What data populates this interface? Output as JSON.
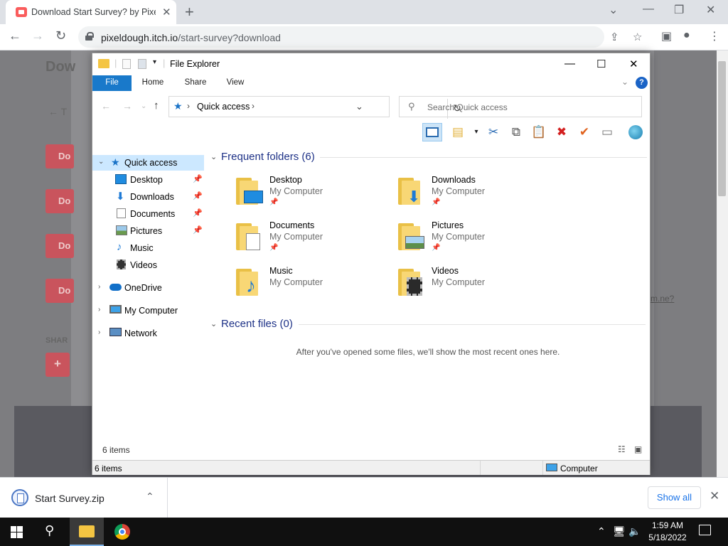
{
  "browser": {
    "tab_title": "Download Start Survey? by PixelD",
    "tab_close": "✕",
    "new_tab": "+",
    "url_host": "pixeldough.itch.io",
    "url_path": "/start-survey?download"
  },
  "page_behind": {
    "heading_fragment": "Dow",
    "back_fragment": "← T",
    "button_fragment": "Do",
    "share_fragment": "SHAR",
    "plus": "+",
    "link_fragment": "m.ne?"
  },
  "explorer": {
    "title": "File Explorer",
    "ribbon_tabs": [
      "File",
      "Home",
      "Share",
      "View"
    ],
    "help": "?",
    "address": "Quick access",
    "search_placeholder": "Search Quick access",
    "nav": [
      {
        "label": "Quick access",
        "icon": "star-icon",
        "pinned": false,
        "expandable": true
      },
      {
        "label": "Desktop",
        "icon": "desktop-icon",
        "pinned": true
      },
      {
        "label": "Downloads",
        "icon": "download-arrow-icon",
        "pinned": true
      },
      {
        "label": "Documents",
        "icon": "documents-icon",
        "pinned": true
      },
      {
        "label": "Pictures",
        "icon": "pictures-icon",
        "pinned": true
      },
      {
        "label": "Music",
        "icon": "music-icon",
        "pinned": false
      },
      {
        "label": "Videos",
        "icon": "videos-icon",
        "pinned": false
      },
      {
        "label": "OneDrive",
        "icon": "cloud-icon",
        "expandable": true
      },
      {
        "label": "My Computer",
        "icon": "computer-icon",
        "expandable": true
      },
      {
        "label": "Network",
        "icon": "network-icon",
        "expandable": true
      }
    ],
    "frequent_header": "Frequent folders (6)",
    "folders": [
      {
        "name": "Desktop",
        "location": "My Computer",
        "pinned": true,
        "overlay": "desktop"
      },
      {
        "name": "Downloads",
        "location": "My Computer",
        "pinned": true,
        "overlay": "download"
      },
      {
        "name": "Documents",
        "location": "My Computer",
        "pinned": true,
        "overlay": "document"
      },
      {
        "name": "Pictures",
        "location": "My Computer",
        "pinned": true,
        "overlay": "picture"
      },
      {
        "name": "Music",
        "location": "My Computer",
        "pinned": false,
        "overlay": "music"
      },
      {
        "name": "Videos",
        "location": "My Computer",
        "pinned": false,
        "overlay": "video"
      }
    ],
    "recent_header": "Recent files (0)",
    "recent_empty": "After you've opened some files, we'll show the most recent ones here.",
    "status_items": "6 items",
    "bottom_items": "6 items",
    "bottom_location": "Computer"
  },
  "downloads": {
    "file": "Start Survey.zip",
    "show_all": "Show all",
    "close": "✕"
  },
  "taskbar": {
    "time": "1:59 AM",
    "date": "5/18/2022"
  },
  "colors": {
    "accent_blue": "#1979ca",
    "folder_yellow": "#f8d775",
    "header_blue": "#1e3287",
    "chrome_link": "#1a73e8"
  }
}
